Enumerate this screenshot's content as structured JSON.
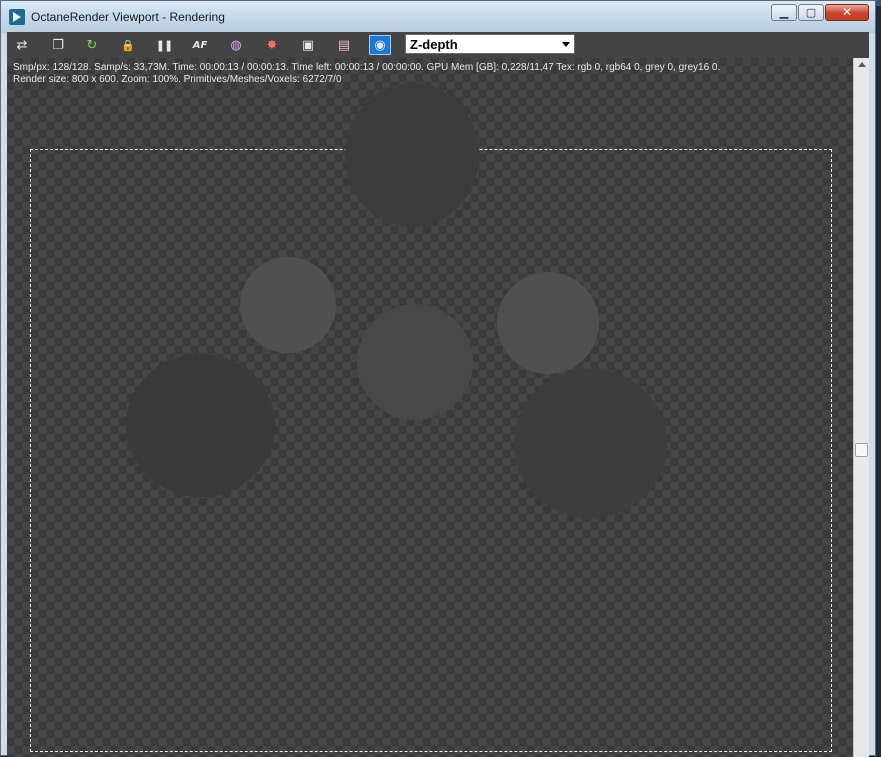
{
  "window": {
    "title": "OctaneRender Viewport - Rendering",
    "minimize_glyph": "▁",
    "maximize_glyph": "▢",
    "close_glyph": "✕"
  },
  "toolbar": {
    "icons": [
      {
        "name": "send-scene-icon",
        "glyph": "⇄"
      },
      {
        "name": "copy-render-icon",
        "glyph": "❐"
      },
      {
        "name": "restart-render-icon",
        "glyph": "↻"
      },
      {
        "name": "lock-icon",
        "glyph": "🔒"
      },
      {
        "name": "pause-icon",
        "glyph": "❚❚"
      },
      {
        "name": "autofocus-icon",
        "glyph": "AF"
      },
      {
        "name": "color-wheel-icon",
        "glyph": "◍"
      },
      {
        "name": "region-render-icon",
        "glyph": "✸"
      },
      {
        "name": "display-icon",
        "glyph": "▣"
      },
      {
        "name": "film-settings-icon",
        "glyph": "▤"
      },
      {
        "name": "camera-icon",
        "glyph": "◉"
      }
    ],
    "view_mode": {
      "selected": "Z-depth"
    }
  },
  "stats": {
    "line1": "Smp/px: 128/128.   Samp/s: 33,73M.   Time: 00:00:13 / 00:00:13.   Time left: 00:00:13 / 00:00:00.   GPU Mem [GB]: 0,228/11,47   Tex: rgb 0, rgb64 0, grey 0, grey16 0.",
    "line2": "Render size: 800 x 600.   Zoom: 100%.   Primitives/Meshes/Voxels: 6272/7/0"
  },
  "render": {
    "sphere_colors": [
      "#3c3c3c",
      "#505050",
      "#484848",
      "#4f4f4f",
      "#3a3a3a",
      "#3d3d3d"
    ]
  }
}
